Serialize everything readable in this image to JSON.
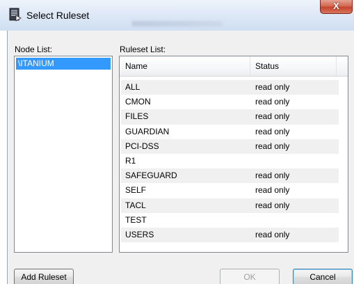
{
  "window": {
    "title": "Select Ruleset",
    "close_glyph": "X"
  },
  "node_list": {
    "label": "Node List:",
    "items": [
      "\\ITANIUM"
    ]
  },
  "ruleset_list": {
    "label": "Ruleset List:",
    "columns": [
      "Name",
      "Status"
    ],
    "rows": [
      {
        "name": "ALL",
        "status": "read only"
      },
      {
        "name": "CMON",
        "status": "read only"
      },
      {
        "name": "FILES",
        "status": "read only"
      },
      {
        "name": "GUARDIAN",
        "status": "read only"
      },
      {
        "name": "PCI-DSS",
        "status": "read only"
      },
      {
        "name": "R1",
        "status": ""
      },
      {
        "name": "SAFEGUARD",
        "status": "read only"
      },
      {
        "name": "SELF",
        "status": "read only"
      },
      {
        "name": "TACL",
        "status": "read only"
      },
      {
        "name": "TEST",
        "status": ""
      },
      {
        "name": "USERS",
        "status": "read only"
      }
    ]
  },
  "buttons": {
    "add_ruleset": "Add Ruleset",
    "ok": "OK",
    "cancel": "Cancel"
  },
  "colors": {
    "selection": "#3399ff",
    "close_button": "#c5452c",
    "row_alt": "#f0f0f0"
  }
}
